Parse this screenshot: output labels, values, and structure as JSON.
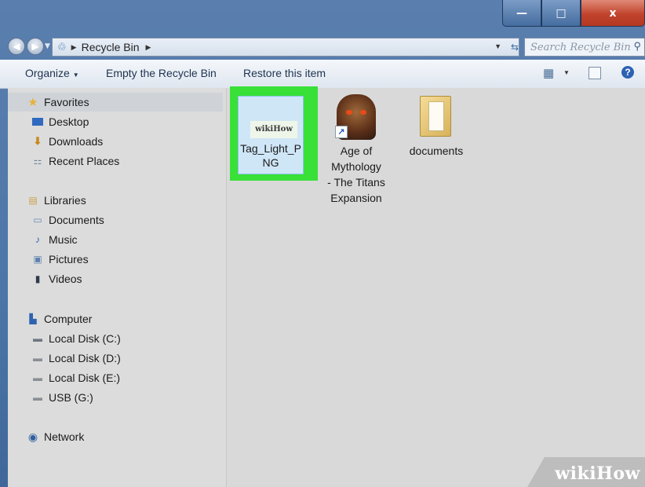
{
  "window": {
    "minimize_glyph": "—",
    "maximize_glyph": "□",
    "close_glyph": "x"
  },
  "address": {
    "path": "Recycle Bin",
    "search_placeholder": "Search Recycle Bin"
  },
  "toolbar": {
    "organize": "Organize",
    "empty": "Empty the Recycle Bin",
    "restore": "Restore this item"
  },
  "nav": {
    "favorites": "Favorites",
    "desktop": "Desktop",
    "downloads": "Downloads",
    "recent": "Recent Places",
    "libraries": "Libraries",
    "documents": "Documents",
    "music": "Music",
    "pictures": "Pictures",
    "videos": "Videos",
    "computer": "Computer",
    "disk_c": "Local Disk (C:)",
    "disk_d": "Local Disk (D:)",
    "disk_e": "Local Disk (E:)",
    "usb": "USB (G:)",
    "network": "Network"
  },
  "files": [
    {
      "name_lines": [
        "Tag_Light_P",
        "NG"
      ],
      "thumb_text": "wikiHow",
      "icon": "image-thumbnail"
    },
    {
      "name_lines": [
        "Age of",
        "Mythology",
        "- The Titans",
        "Expansion"
      ],
      "icon": "game-shortcut"
    },
    {
      "name_lines": [
        "documents"
      ],
      "icon": "folder"
    }
  ],
  "watermark": "wikiHow"
}
